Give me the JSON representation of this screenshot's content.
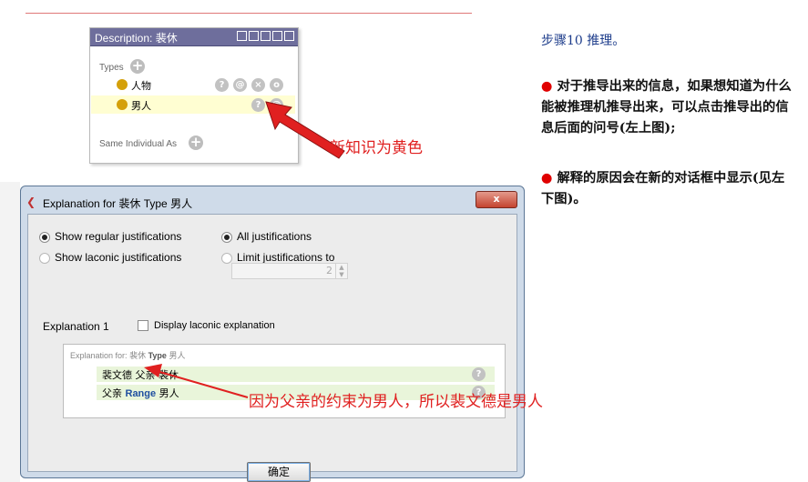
{
  "description_panel": {
    "title": "Description: 裴休",
    "title_buttons": [
      "help",
      "restore",
      "minimize",
      "maximize",
      "close"
    ],
    "types_label": "Types",
    "types": [
      {
        "label": "人物",
        "highlighted": false,
        "actions": [
          "?",
          "@",
          "×",
          "o"
        ]
      },
      {
        "label": "男人",
        "highlighted": true,
        "actions": [
          "?",
          "@"
        ]
      }
    ],
    "same_individual_label": "Same Individual As"
  },
  "annotations": {
    "new_knowledge": "新知识为黄色",
    "reason": "因为父亲的约束为男人，所以裴文德是男人"
  },
  "right_text": {
    "step": "步骤10 推理。",
    "bullet1": "对于推导出来的信息，如果想知道为什么能被推理机推导出来，可以点击推导出的信息后面的问号(左上图);",
    "bullet2": "解释的原因会在新的对话框中显示(见左下图)。",
    "bullet_glyph": "●"
  },
  "dialog": {
    "title": "Explanation for 裴休 Type 男人",
    "close_label": "x",
    "options": {
      "regular": "Show regular justifications",
      "laconic": "Show laconic justifications",
      "all": "All justifications",
      "limit": "Limit justifications to",
      "limit_value": "2"
    },
    "explanation_label": "Explanation 1",
    "display_laconic": "Display laconic explanation",
    "explanation_for_prefix": "Explanation for:",
    "explanation_for_subject": "裴休",
    "explanation_for_type_kw": "Type",
    "explanation_for_object": "男人",
    "rows": [
      {
        "text": "裴文德 父亲 裴休",
        "q": "?"
      },
      {
        "prefix": "父亲",
        "keyword": "Range",
        "suffix": "男人",
        "q": "?"
      }
    ],
    "ok_label": "确定"
  },
  "colors": {
    "accent_red": "#e02020",
    "title_bar": "#6e6e9c",
    "highlight_row": "#fffed2",
    "explanation_row": "#e9f5da",
    "type_dot": "#d4a00a",
    "keyword_blue": "#1f4fa0"
  }
}
